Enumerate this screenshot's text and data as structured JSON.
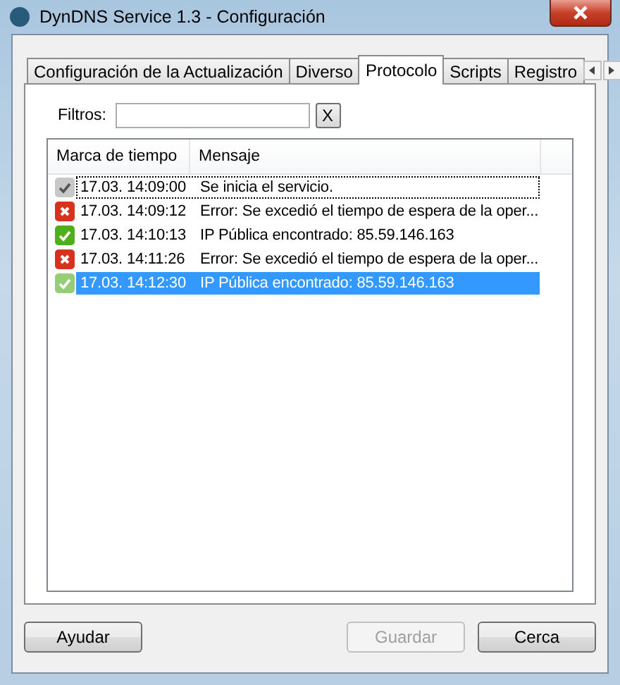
{
  "window": {
    "title": "DynDNS Service 1.3 - Configuración"
  },
  "tabs": [
    {
      "label": "Configuración de la Actualización",
      "selected": false
    },
    {
      "label": "Diverso",
      "selected": false
    },
    {
      "label": "Protocolo",
      "selected": true
    },
    {
      "label": "Scripts",
      "selected": false
    },
    {
      "label": "Registro",
      "selected": false
    }
  ],
  "filter": {
    "label": "Filtros:",
    "clear_button": "X"
  },
  "log": {
    "columns": [
      "Marca de tiempo",
      "Mensaje"
    ],
    "rows": [
      {
        "kind": "info",
        "time": "17.03. 14:09:00",
        "message": "Se inicia el servicio.",
        "selected": false,
        "focused": true
      },
      {
        "kind": "error",
        "time": "17.03. 14:09:12",
        "message": "Error: Se excedió el tiempo de espera de la oper...",
        "selected": false,
        "focused": false
      },
      {
        "kind": "success",
        "time": "17.03. 14:10:13",
        "message": "IP Pública encontrado: 85.59.146.163",
        "selected": false,
        "focused": false
      },
      {
        "kind": "error",
        "time": "17.03. 14:11:26",
        "message": "Error: Se excedió el tiempo de espera de la oper...",
        "selected": false,
        "focused": false
      },
      {
        "kind": "success",
        "time": "17.03. 14:12:30",
        "message": "IP Pública encontrado: 85.59.146.163",
        "selected": true,
        "focused": false
      }
    ]
  },
  "buttons": [
    {
      "label": "Ayudar",
      "disabled": false
    },
    {
      "label": "Guardar",
      "disabled": true
    },
    {
      "label": "Cerca",
      "disabled": false
    }
  ]
}
